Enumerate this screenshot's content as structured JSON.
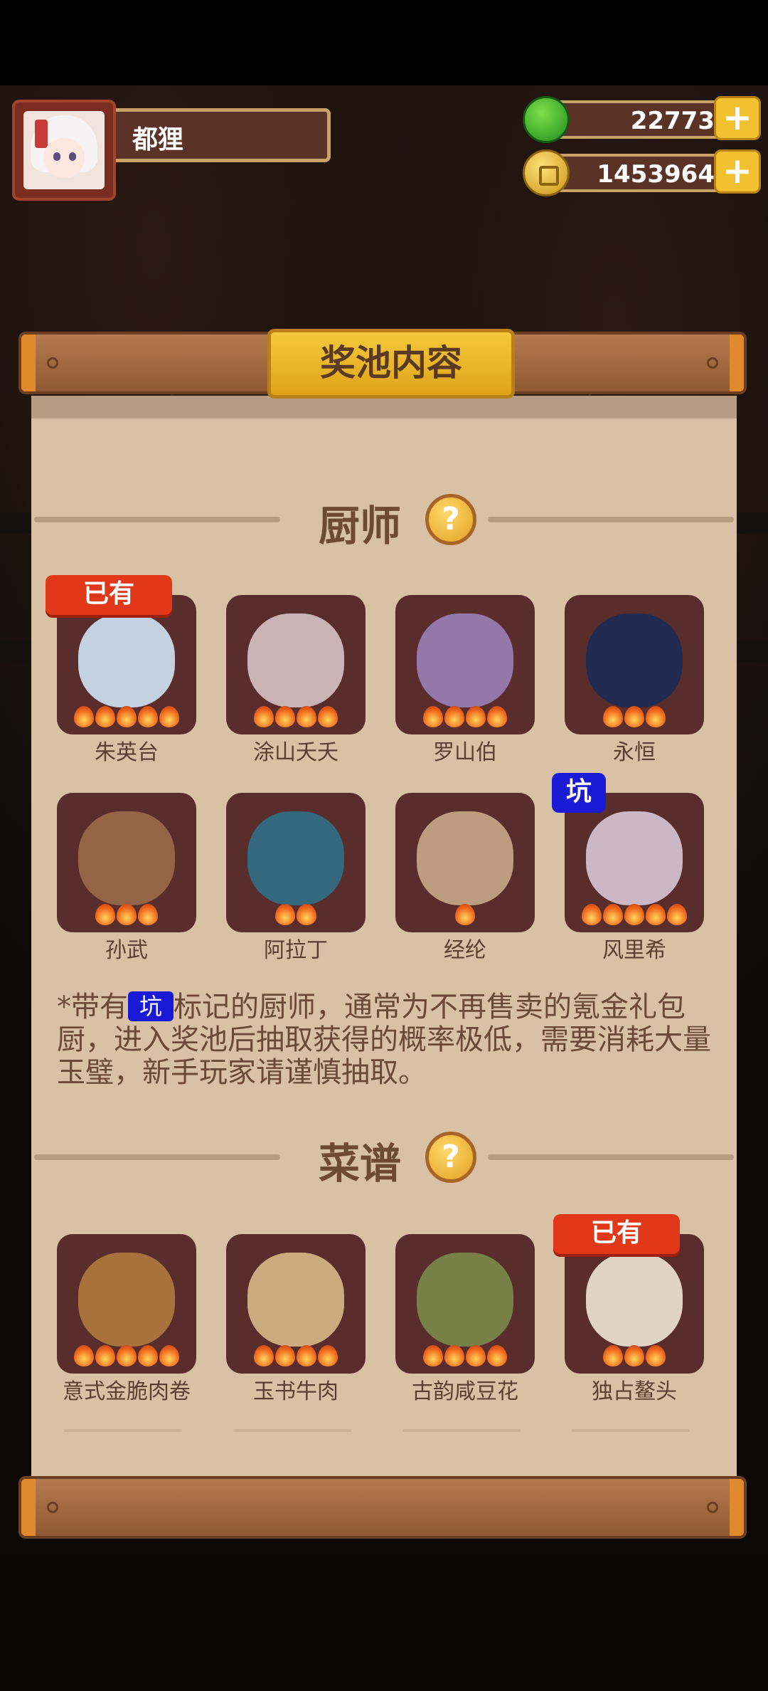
{
  "player": {
    "name": "都狸"
  },
  "currency": {
    "gems": {
      "value": "22773",
      "icon": "green-gem-icon"
    },
    "coins": {
      "value": "1453964",
      "icon": "gold-coin-icon"
    },
    "plus_label": "+"
  },
  "panel": {
    "title": "奖池内容"
  },
  "chefs_section": {
    "title": "厨师",
    "help_label": "?",
    "items": [
      {
        "name": "朱英台",
        "stars": 5,
        "owned": true,
        "pit": false,
        "color": "#cfe3f5"
      },
      {
        "name": "涂山夭夭",
        "stars": 4,
        "owned": false,
        "pit": false,
        "color": "#d7c2c2"
      },
      {
        "name": "罗山伯",
        "stars": 4,
        "owned": false,
        "pit": false,
        "color": "#9b7fb8"
      },
      {
        "name": "永恒",
        "stars": 3,
        "owned": false,
        "pit": false,
        "color": "#1b2a55"
      },
      {
        "name": "孙武",
        "stars": 3,
        "owned": false,
        "pit": false,
        "color": "#9a6a4a"
      },
      {
        "name": "阿拉丁",
        "stars": 2,
        "owned": false,
        "pit": false,
        "color": "#2f6f86"
      },
      {
        "name": "经纶",
        "stars": 1,
        "owned": false,
        "pit": false,
        "color": "#c9a888"
      },
      {
        "name": "风里希",
        "stars": 5,
        "owned": false,
        "pit": true,
        "color": "#d8c6d6"
      }
    ],
    "owned_label": "已有",
    "pit_label": "坑"
  },
  "note": {
    "prefix": "*带有",
    "pit_label": "坑",
    "suffix": "标记的厨师，通常为不再售卖的氪金礼包厨，进入奖池后抽取获得的概率极低，需要消耗大量玉璧，新手玩家请谨慎抽取。"
  },
  "recipes_section": {
    "title": "菜谱",
    "help_label": "?",
    "items": [
      {
        "name": "意式金脆肉卷",
        "stars": 5,
        "owned": false,
        "color": "#b07a3e"
      },
      {
        "name": "玉书牛肉",
        "stars": 4,
        "owned": false,
        "color": "#d9b98a"
      },
      {
        "name": "古韵咸豆花",
        "stars": 4,
        "owned": false,
        "color": "#7a8a4a"
      },
      {
        "name": "独占鳌头",
        "stars": 3,
        "owned": true,
        "color": "#f0e6d6"
      }
    ],
    "owned_label": "已有"
  }
}
